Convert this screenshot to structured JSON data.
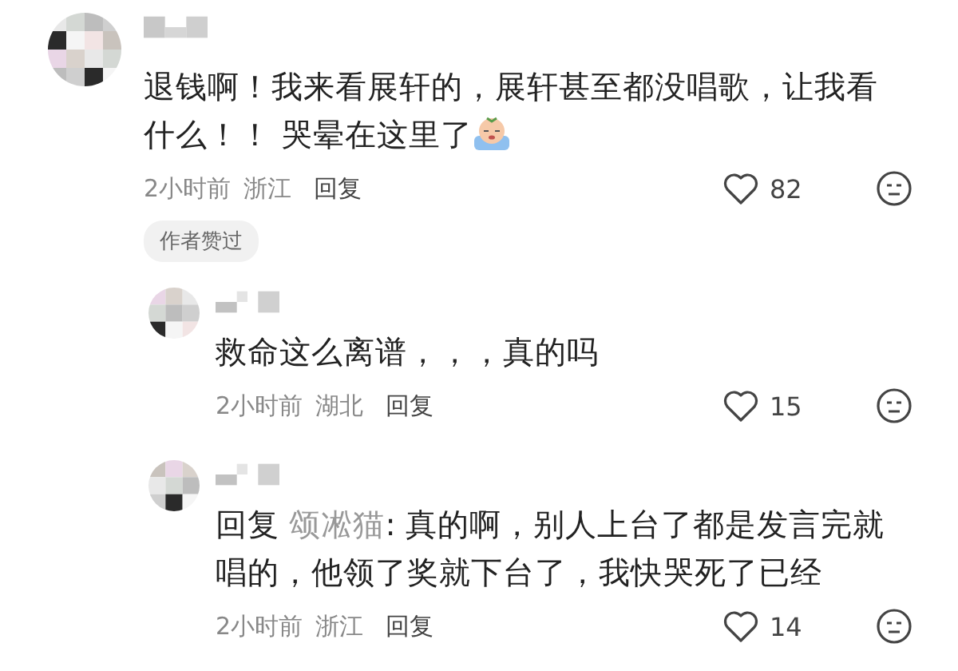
{
  "comments": [
    {
      "text": "退钱啊！我来看展轩的，展轩甚至都没唱歌，让我看什么！！ 哭晕在这里了",
      "sticker": true,
      "time": "2小时前",
      "location": "浙江",
      "reply_action": "回复",
      "likes": "82",
      "badge": "作者赞过",
      "replies": [
        {
          "text": "救命这么离谱，，，真的吗",
          "time": "2小时前",
          "location": "湖北",
          "reply_action": "回复",
          "likes": "15"
        },
        {
          "reply_label": "回复",
          "reply_to": "颂凇猫",
          "text": ": 真的啊，别人上台了都是发言完就唱的，他领了奖就下台了，我快哭死了已经",
          "time": "2小时前",
          "location": "浙江",
          "reply_action": "回复",
          "likes": "14"
        }
      ]
    }
  ]
}
